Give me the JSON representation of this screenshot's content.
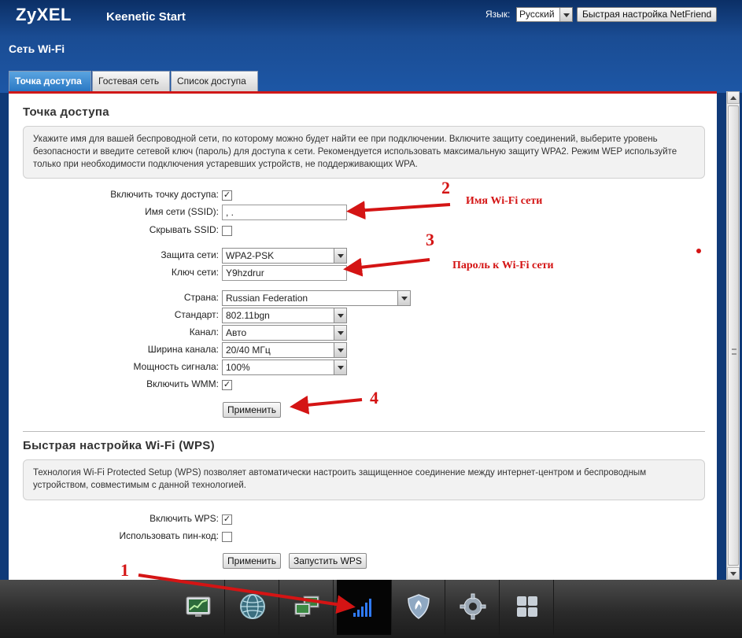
{
  "header": {
    "logo": "ZyXEL",
    "product": "Keenetic Start",
    "language_label": "Язык:",
    "language_value": "Русский",
    "netfriend_button": "Быстрая настройка NetFriend"
  },
  "page": {
    "title": "Сеть Wi-Fi",
    "tabs": [
      {
        "label": "Точка доступа",
        "active": true
      },
      {
        "label": "Гостевая сеть",
        "active": false
      },
      {
        "label": "Список доступа",
        "active": false
      }
    ]
  },
  "access_point": {
    "title": "Точка доступа",
    "info": "Укажите имя для вашей беспроводной сети, по которому можно будет найти ее при подключении. Включите защиту соединений, выберите уровень безопасности и введите сетевой ключ (пароль) для доступа к сети. Рекомендуется использовать максимальную защиту WPA2. Режим WEP используйте только при необходимости подключения устаревших устройств, не поддерживающих WPA.",
    "enable_label": "Включить точку доступа:",
    "enable_checked": true,
    "ssid_label": "Имя сети (SSID):",
    "ssid_value": ",  .",
    "hide_ssid_label": "Скрывать SSID:",
    "hide_ssid_checked": false,
    "security_label": "Защита сети:",
    "security_value": "WPA2-PSK",
    "key_label": "Ключ сети:",
    "key_value": "Y9hzdrur",
    "country_label": "Страна:",
    "country_value": "Russian Federation",
    "standard_label": "Стандарт:",
    "standard_value": "802.11bgn",
    "channel_label": "Канал:",
    "channel_value": "Авто",
    "bandwidth_label": "Ширина канала:",
    "bandwidth_value": "20/40 МГц",
    "power_label": "Мощность сигнала:",
    "power_value": "100%",
    "wmm_label": "Включить WMM:",
    "wmm_checked": true,
    "apply_button": "Применить"
  },
  "wps": {
    "title": "Быстрая настройка Wi-Fi (WPS)",
    "info": "Технология Wi-Fi Protected Setup (WPS) позволяет автоматически настроить защищенное соединение между интернет-центром и беспроводным устройством, совместимым с данной технологией.",
    "enable_label": "Включить WPS:",
    "enable_checked": true,
    "pin_label": "Использовать пин-код:",
    "pin_checked": false,
    "apply_button": "Применить",
    "start_button": "Запустить WPS"
  },
  "annotations": {
    "n1": "1",
    "n2": "2",
    "n3": "3",
    "n4": "4",
    "wifi_name": "Имя Wi-Fi сети",
    "wifi_password": "Пароль к Wi-Fi сети"
  },
  "dock": {
    "icons": [
      "monitor-icon",
      "globe-icon",
      "network-computers-icon",
      "wifi-signal-icon",
      "shield-icon",
      "gear-icon",
      "apps-grid-icon"
    ],
    "active_index": 3,
    "accent_color": "#2f7bff"
  },
  "colors": {
    "header_blue": "#1a4c93",
    "accent_red": "#d01818",
    "annotation_red": "#d41414",
    "tab_active": "#2a78c4"
  }
}
